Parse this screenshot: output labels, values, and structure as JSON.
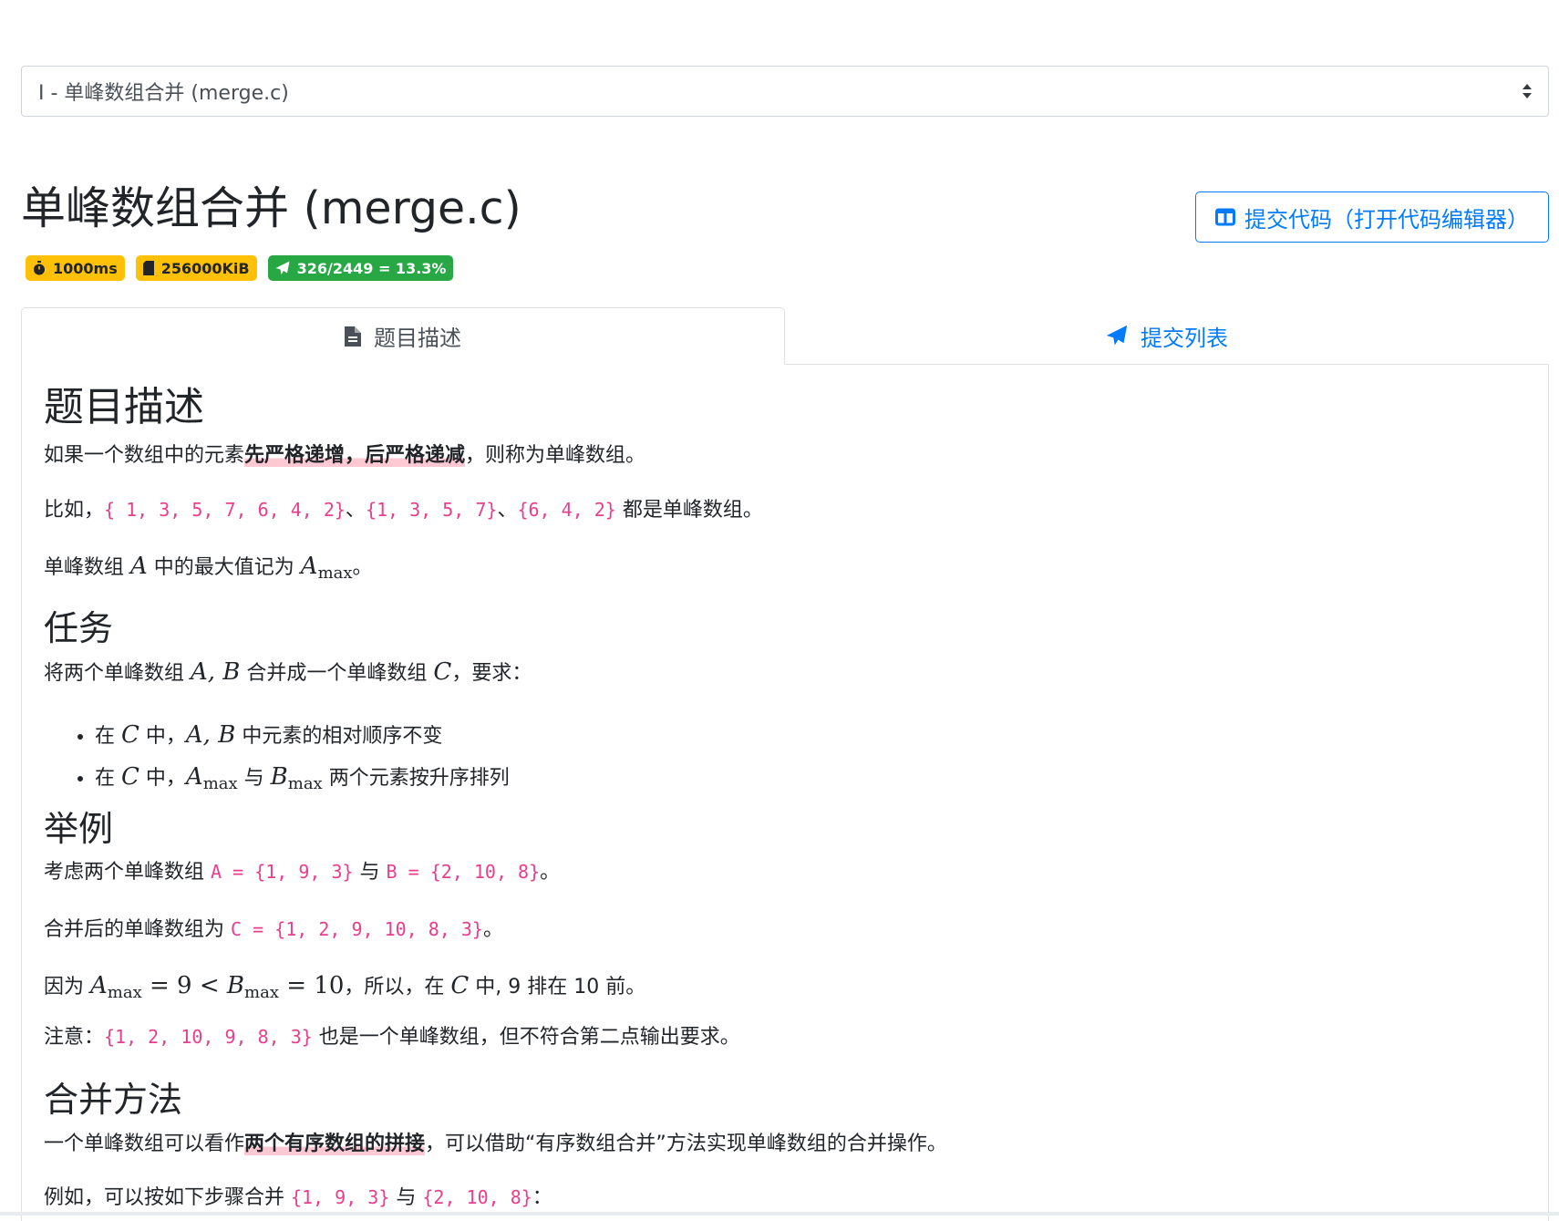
{
  "problem_select": {
    "value": "I - 单峰数组合并 (merge.c)"
  },
  "title": "单峰数组合并 (merge.c)",
  "submit_button": {
    "label": "提交代码（打开代码编辑器）",
    "icon": "columns-icon"
  },
  "badges": {
    "time": "1000ms",
    "memory": "256000KiB",
    "accept_rate": "326/2449 = 13.3%"
  },
  "colors": {
    "accent": "#007bff",
    "warning": "#ffc107",
    "success": "#28a745",
    "code": "#e83e8c"
  },
  "tabs": [
    {
      "label": "题目描述",
      "icon": "file-icon",
      "active": true
    },
    {
      "label": "提交列表",
      "icon": "paper-plane-icon",
      "active": false
    }
  ],
  "content": {
    "h_desc": "题目描述",
    "desc_p1_pre": "如果一个数组中的元素",
    "desc_p1_hl": "先严格递增，后严格递减",
    "desc_p1_post": "，则称为单峰数组。",
    "desc_p2_pre": "比如，",
    "desc_p2_code1": "{ 1, 3, 5, 7, 6, 4, 2}",
    "desc_p2_sep1": "、",
    "desc_p2_code2": "{1, 3, 5, 7}",
    "desc_p2_sep2": "、",
    "desc_p2_code3": "{6, 4, 2}",
    "desc_p2_post": " 都是单峰数组。",
    "desc_p3_pre": "单峰数组 ",
    "desc_p3_mid": " 中的最大值记为 ",
    "desc_p3_post": "。",
    "h_task": "任务",
    "task_p1_pre": "将两个单峰数组 ",
    "task_p1_mid": " 合并成一个单峰数组 ",
    "task_p1_post": "，要求：",
    "task_li1_pre": "在 ",
    "task_li1_mid": " 中，",
    "task_li1_post": " 中元素的相对顺序不变",
    "task_li2_pre": "在 ",
    "task_li2_mid": " 中，",
    "task_li2_and": " 与 ",
    "task_li2_post": " 两个元素按升序排列",
    "h_example": "举例",
    "ex_p1_pre": "考虑两个单峰数组 ",
    "ex_p1_code1": "A = {1, 9, 3}",
    "ex_p1_and": " 与 ",
    "ex_p1_code2": "B = {2, 10, 8}",
    "ex_p1_post": "。",
    "ex_p2_pre": "合并后的单峰数组为 ",
    "ex_p2_code": "C = {1, 2, 9, 10, 8, 3}",
    "ex_p2_post": "。",
    "ex_p3_pre": "因为 ",
    "ex_p3_post": "，所以，在 ",
    "ex_p3_tail": " 中, 9 排在 10 前。",
    "ex_p4_pre": "注意：",
    "ex_p4_code": "{1, 2, 10, 9, 8, 3}",
    "ex_p4_post": " 也是一个单峰数组，但不符合第二点输出要求。",
    "h_method": "合并方法",
    "m_p1_pre": "一个单峰数组可以看作",
    "m_p1_hl": "两个有序数组的拼接",
    "m_p1_post": "，可以借助“有序数组合并”方法实现单峰数组的合并操作。",
    "m_p2_pre": "例如，可以按如下步骤合并 ",
    "m_p2_code1": "{1, 9, 3}",
    "m_p2_and": " 与 ",
    "m_p2_code2": "{2, 10, 8}",
    "m_p2_post": "："
  }
}
